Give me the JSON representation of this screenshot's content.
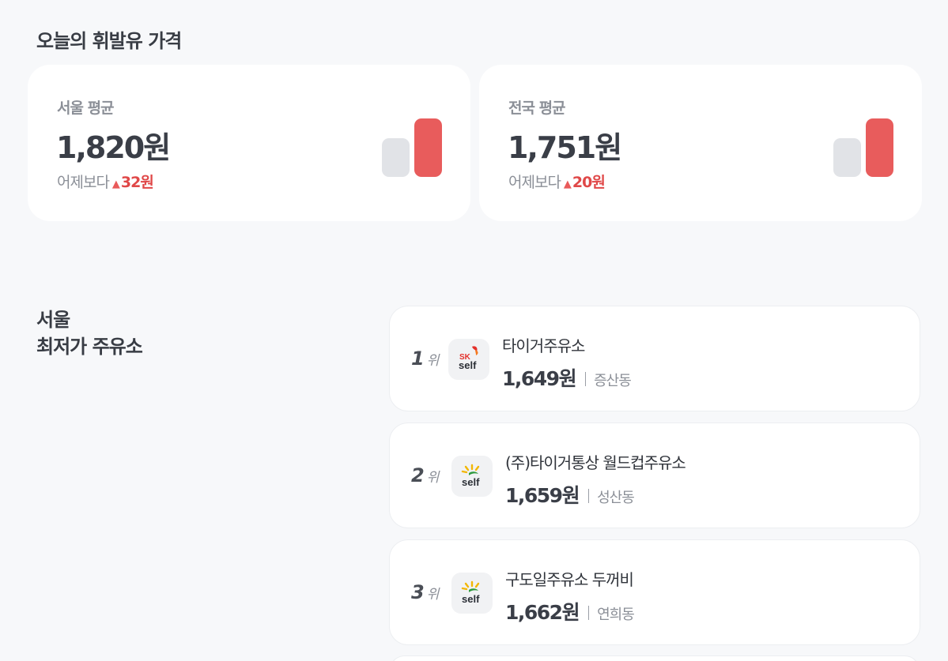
{
  "section_title": "오늘의 휘발유 가격",
  "averages": [
    {
      "label": "서울 평균",
      "price": "1,820원",
      "change_prefix": "어제보다",
      "change_arrow": "▲",
      "change_amount": "32원",
      "chart_icon": "bar-chart-icon"
    },
    {
      "label": "전국 평균",
      "price": "1,751원",
      "change_prefix": "어제보다",
      "change_arrow": "▲",
      "change_amount": "20원",
      "chart_icon": "bar-chart-icon"
    }
  ],
  "ranking": {
    "title_line1": "서울",
    "title_line2": "최저가 주유소",
    "rank_unit": "위",
    "stations": [
      {
        "rank": "1",
        "brand": "SK self",
        "logo_top": "SK",
        "logo_bottom": "self",
        "name": "타이거주유소",
        "price": "1,649원",
        "district": "증산동"
      },
      {
        "rank": "2",
        "brand": "S-OIL self",
        "logo_bottom": "self",
        "name": "(주)타이거통상 월드컵주유소",
        "price": "1,659원",
        "district": "성산동"
      },
      {
        "rank": "3",
        "brand": "S-OIL self",
        "logo_bottom": "self",
        "name": "구도일주유소 두꺼비",
        "price": "1,662원",
        "district": "연희동"
      }
    ]
  },
  "colors": {
    "background": "#f7f8fa",
    "card": "#ffffff",
    "accent_red": "#e85c5c",
    "bar_gray": "#e1e3e7",
    "text_dark": "#3a3e47",
    "text_muted": "#8b8f97"
  }
}
